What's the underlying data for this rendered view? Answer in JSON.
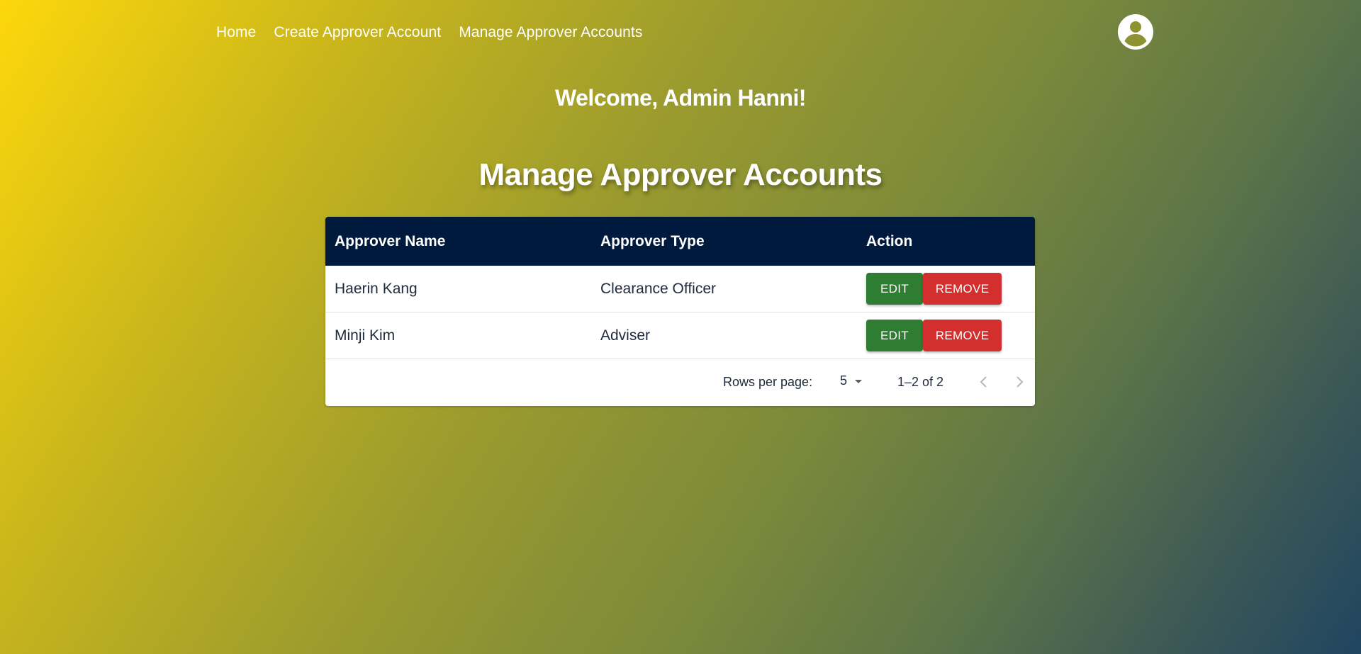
{
  "nav": {
    "items": [
      {
        "label": "Home"
      },
      {
        "label": "Create Approver Account"
      },
      {
        "label": "Manage Approver Accounts"
      }
    ],
    "avatar_icon": "account-circle-icon"
  },
  "welcome": "Welcome, Admin Hanni!",
  "page_title": "Manage Approver Accounts",
  "table": {
    "headers": {
      "name": "Approver Name",
      "type": "Approver Type",
      "action": "Action"
    },
    "rows": [
      {
        "name": "Haerin Kang",
        "type": "Clearance Officer",
        "edit_label": "EDIT",
        "remove_label": "REMOVE"
      },
      {
        "name": "Minji Kim",
        "type": "Adviser",
        "edit_label": "EDIT",
        "remove_label": "REMOVE"
      }
    ],
    "pagination": {
      "rows_per_page_label": "Rows per page:",
      "rows_per_page_value": "5",
      "range": "1–2 of 2"
    }
  },
  "colors": {
    "header_bg": "#001a3d",
    "edit": "#2e7d32",
    "remove": "#d32f2f"
  }
}
